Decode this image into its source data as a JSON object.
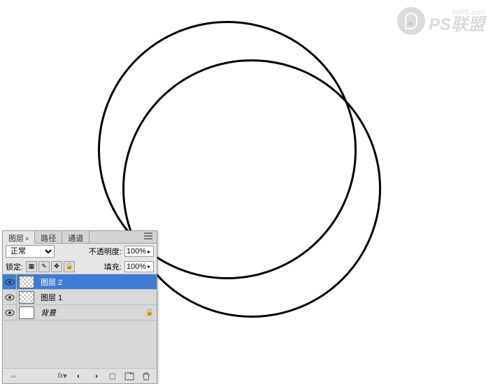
{
  "watermark": {
    "url": "68PS.com",
    "brand": "PS联盟"
  },
  "panel": {
    "tabs": {
      "layers": "图层",
      "paths": "路径",
      "channels": "通道"
    },
    "blend_mode": "正常",
    "opacity_label": "不透明度:",
    "opacity_value": "100%",
    "lock_label": "锁定:",
    "fill_label": "填充:",
    "fill_value": "100%",
    "layers": [
      {
        "name": "图层 2",
        "locked": false
      },
      {
        "name": "图层 1",
        "locked": false
      },
      {
        "name": "背景",
        "locked": true
      }
    ]
  }
}
